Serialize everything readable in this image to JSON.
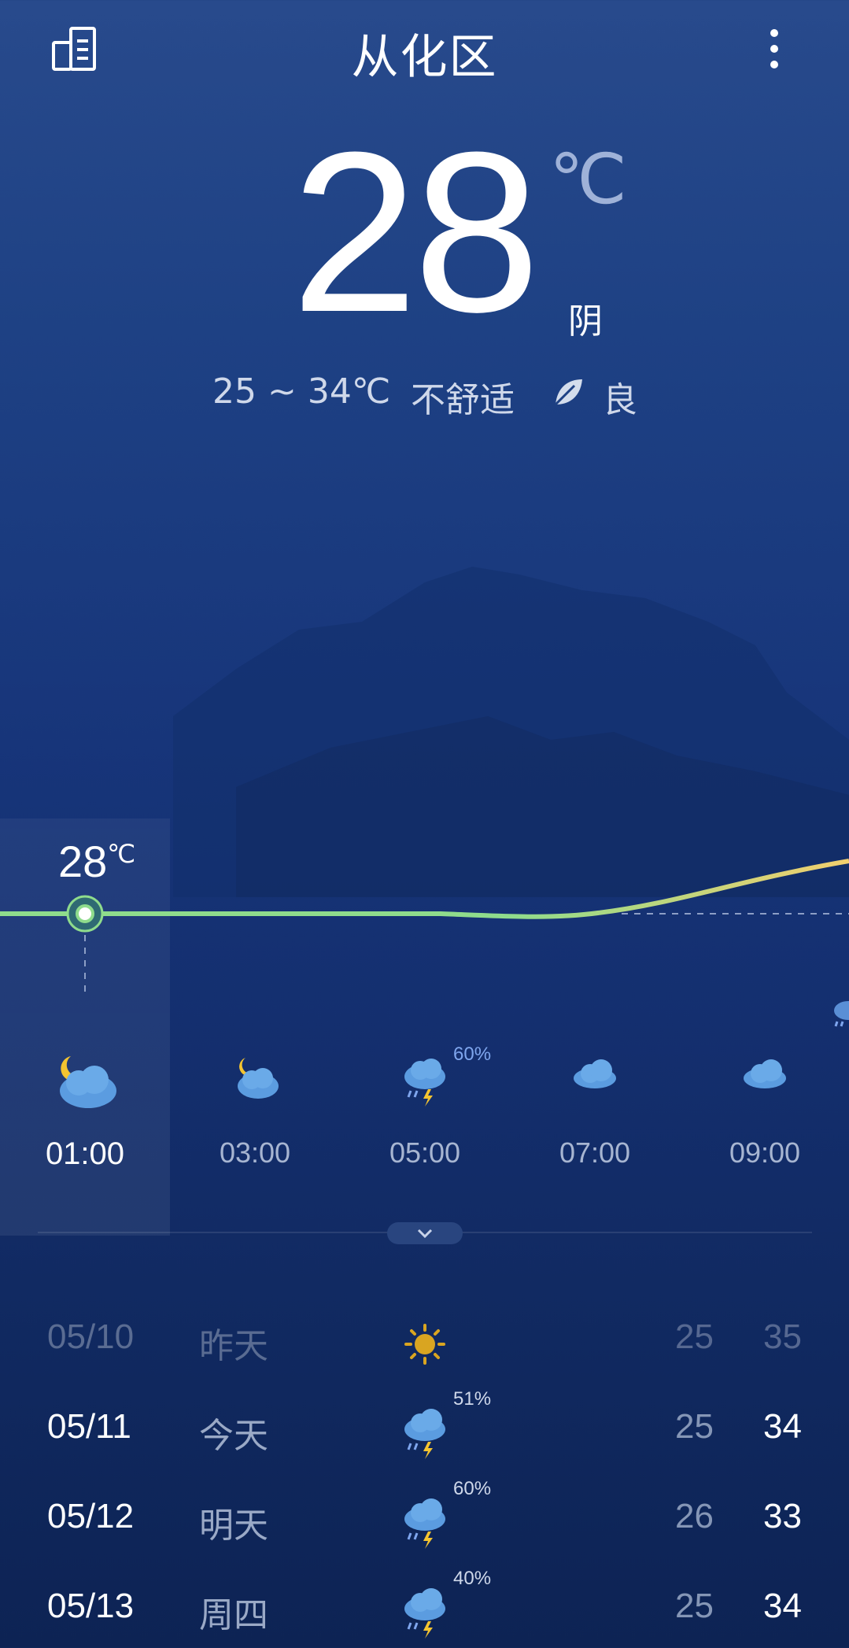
{
  "header": {
    "city": "从化区"
  },
  "current": {
    "temp": "28",
    "unit": "℃",
    "condition": "阴",
    "range": "25 ~ 34℃",
    "comfort": "不舒适",
    "air_quality": "良"
  },
  "hourly": {
    "current_temp": "28",
    "current_unit": "℃",
    "hours": [
      {
        "time": "01:00",
        "icon": "moon-cloud-icon",
        "precip": ""
      },
      {
        "time": "03:00",
        "icon": "moon-cloud-icon",
        "precip": ""
      },
      {
        "time": "05:00",
        "icon": "thunderstorm-icon",
        "precip": "60%"
      },
      {
        "time": "07:00",
        "icon": "cloud-icon",
        "precip": ""
      },
      {
        "time": "09:00",
        "icon": "cloud-icon",
        "precip": ""
      }
    ]
  },
  "daily": [
    {
      "date": "05/10",
      "weekday": "昨天",
      "icon": "sun-icon",
      "precip": "",
      "low": "25",
      "high": "35"
    },
    {
      "date": "05/11",
      "weekday": "今天",
      "icon": "thunderstorm-icon",
      "precip": "51%",
      "low": "25",
      "high": "34"
    },
    {
      "date": "05/12",
      "weekday": "明天",
      "icon": "thunderstorm-icon",
      "precip": "60%",
      "low": "26",
      "high": "33"
    },
    {
      "date": "05/13",
      "weekday": "周四",
      "icon": "thunderstorm-icon",
      "precip": "40%",
      "low": "25",
      "high": "34"
    }
  ],
  "colors": {
    "temp_curve_start": "#8fdc8c",
    "temp_curve_end": "#f2cf6e",
    "accent_precip": "#7fa6ee"
  }
}
